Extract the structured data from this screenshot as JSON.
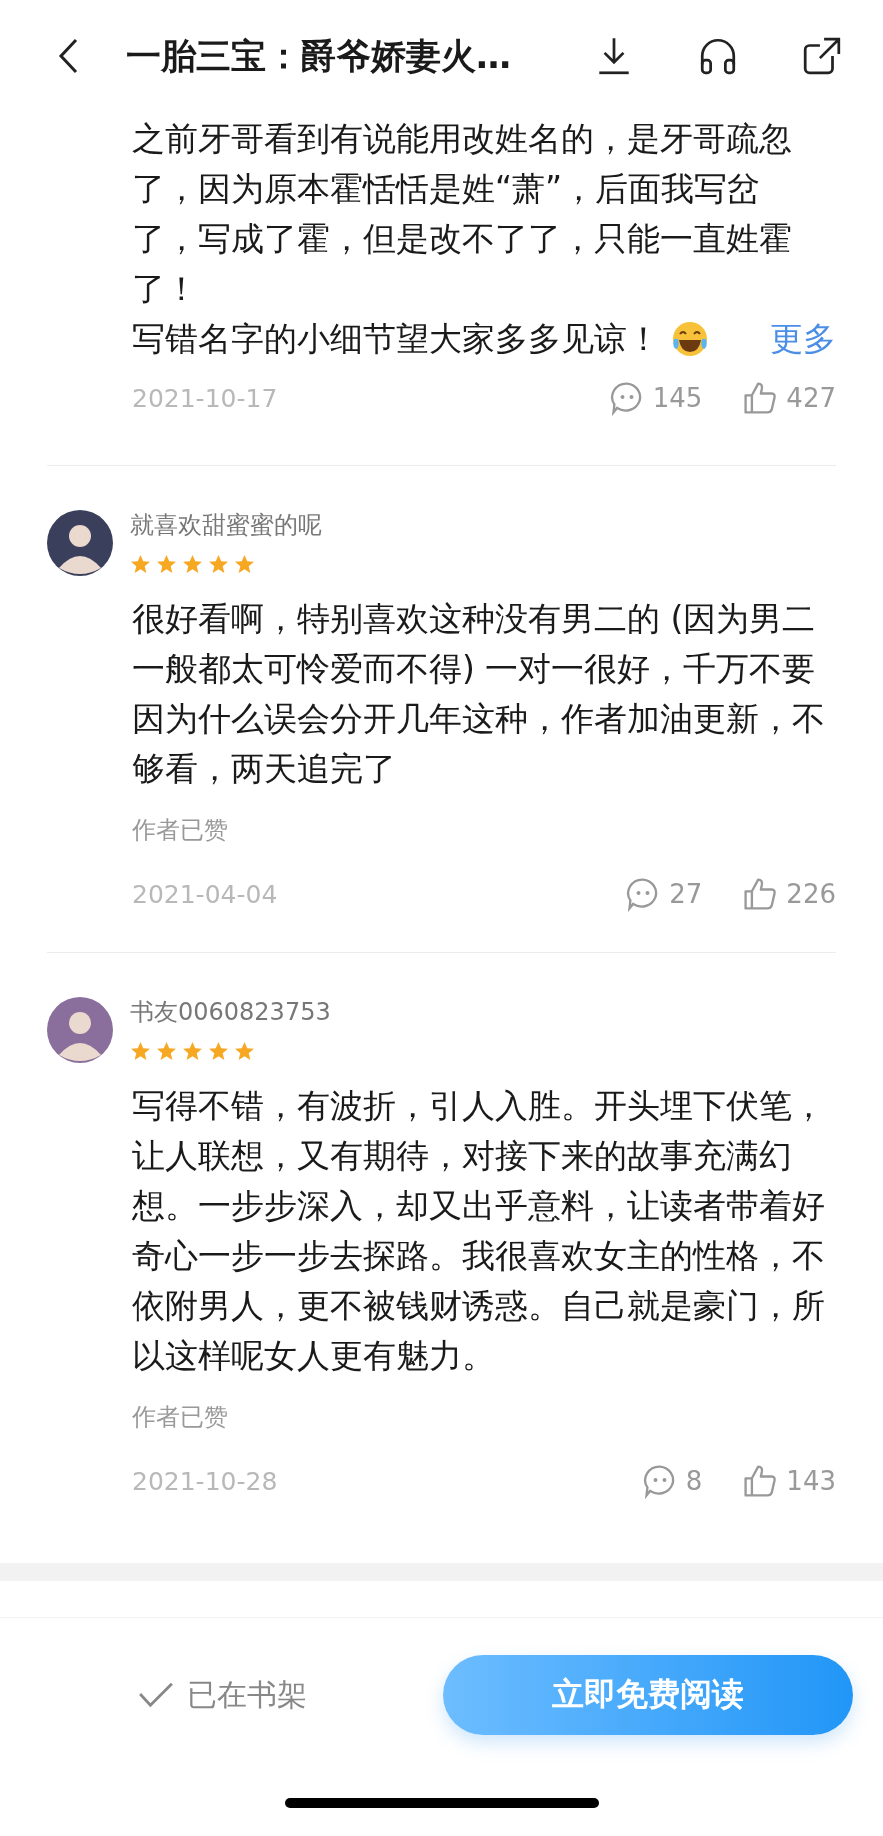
{
  "header": {
    "title": "一胎三宝：爵爷娇妻火…"
  },
  "reviews": [
    {
      "kind": "excerpt",
      "paragraphs": [
        "之前牙哥看到有说能用改姓名的，是牙哥疏忽了，因为原本霍恬恬是姓“萧”，后面我写岔了，写成了霍，但是改不了了，只能一直姓霍了！"
      ],
      "last_line": "写错名字的小细节望大家多多见谅！",
      "more": "更多",
      "date": "2021-10-17",
      "replies": "145",
      "likes": "427"
    },
    {
      "kind": "full",
      "username": "就喜欢甜蜜蜜的呢",
      "stars": 5,
      "text": "很好看啊，特别喜欢这种没有男二的 (因为男二一般都太可怜爱而不得) 一对一很好，千万不要因为什么误会分开几年这种，作者加油更新，不够看，两天追完了",
      "author_liked": "作者已赞",
      "date": "2021-04-04",
      "replies": "27",
      "likes": "226"
    },
    {
      "kind": "full",
      "username": "书友0060823753",
      "stars": 5,
      "text": "写得不错，有波折，引人入胜。开头埋下伏笔，让人联想，又有期待，对接下来的故事充满幻想。一步步深入，却又出乎意料，让读者带着好奇心一步一步去探路。我很喜欢女主的性格，不依附男人，更不被钱财诱惑。自己就是豪门，所以这样呢女人更有魅力。",
      "author_liked": "作者已赞",
      "date": "2021-10-28",
      "replies": "8",
      "likes": "143"
    }
  ],
  "bottom_bar": {
    "shelf": {
      "label": "已在书架",
      "checked": true
    },
    "read_button": "立即免费阅读"
  }
}
